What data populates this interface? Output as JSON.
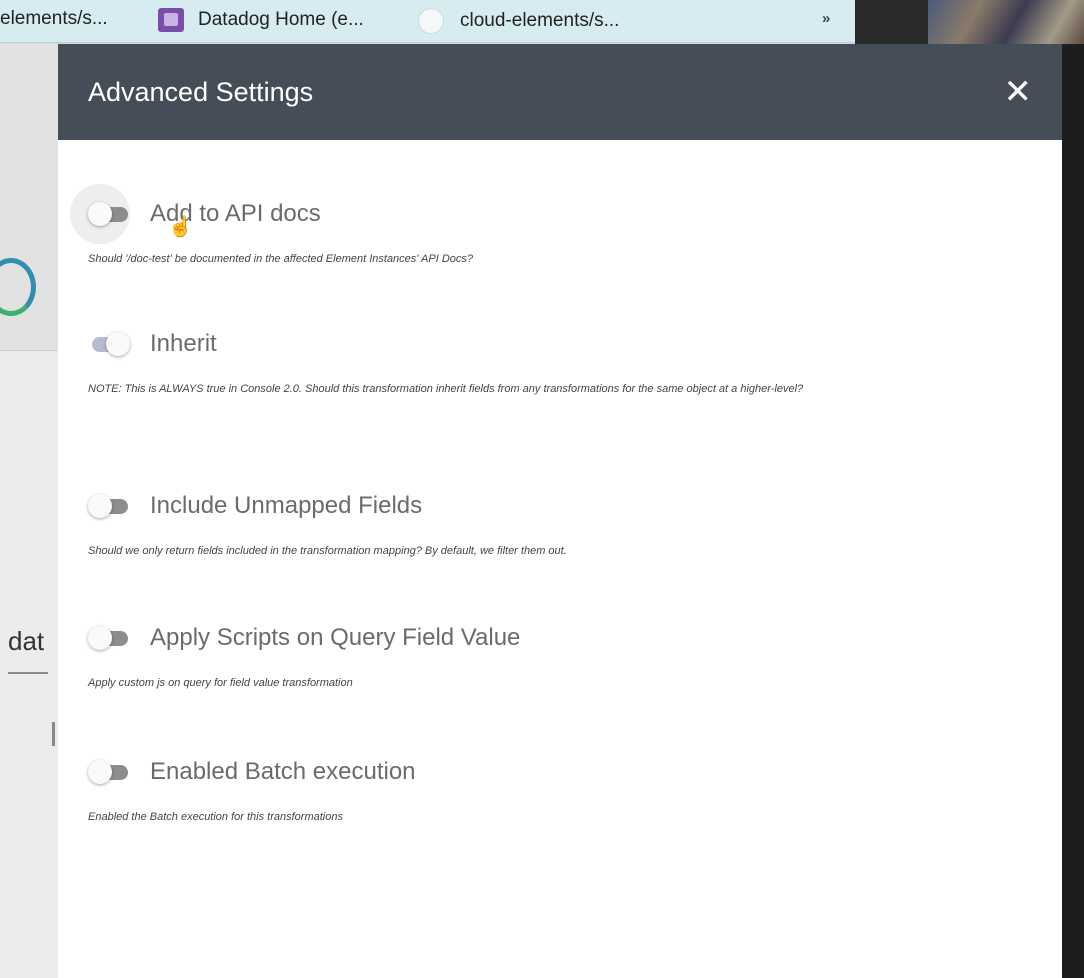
{
  "browser": {
    "bookmarks": [
      {
        "label": "elements/s...",
        "icon": "none"
      },
      {
        "label": "Datadog Home (e...",
        "icon": "datadog-icon"
      },
      {
        "label": "cloud-elements/s...",
        "icon": "github-icon"
      }
    ],
    "overflow_label": "»"
  },
  "background": {
    "partial_text": "dat"
  },
  "modal": {
    "title": "Advanced Settings",
    "close_label": "✕",
    "settings": [
      {
        "label": "Add to API docs",
        "enabled": false,
        "description": "Should '/doc-test' be documented in the affected Element Instances' API Docs?"
      },
      {
        "label": "Inherit",
        "enabled": true,
        "description": "NOTE: This is ALWAYS true in Console 2.0. Should this transformation inherit fields from any transformations for the same object at a higher-level?"
      },
      {
        "label": "Include Unmapped Fields",
        "enabled": false,
        "description": "Should we only return fields included in the transformation mapping? By default, we filter them out."
      },
      {
        "label": "Apply Scripts on Query Field Value",
        "enabled": false,
        "description": "Apply custom js on query for field value transformation"
      },
      {
        "label": "Enabled Batch execution",
        "enabled": false,
        "description": "Enabled the Batch execution for this transformations"
      }
    ]
  }
}
